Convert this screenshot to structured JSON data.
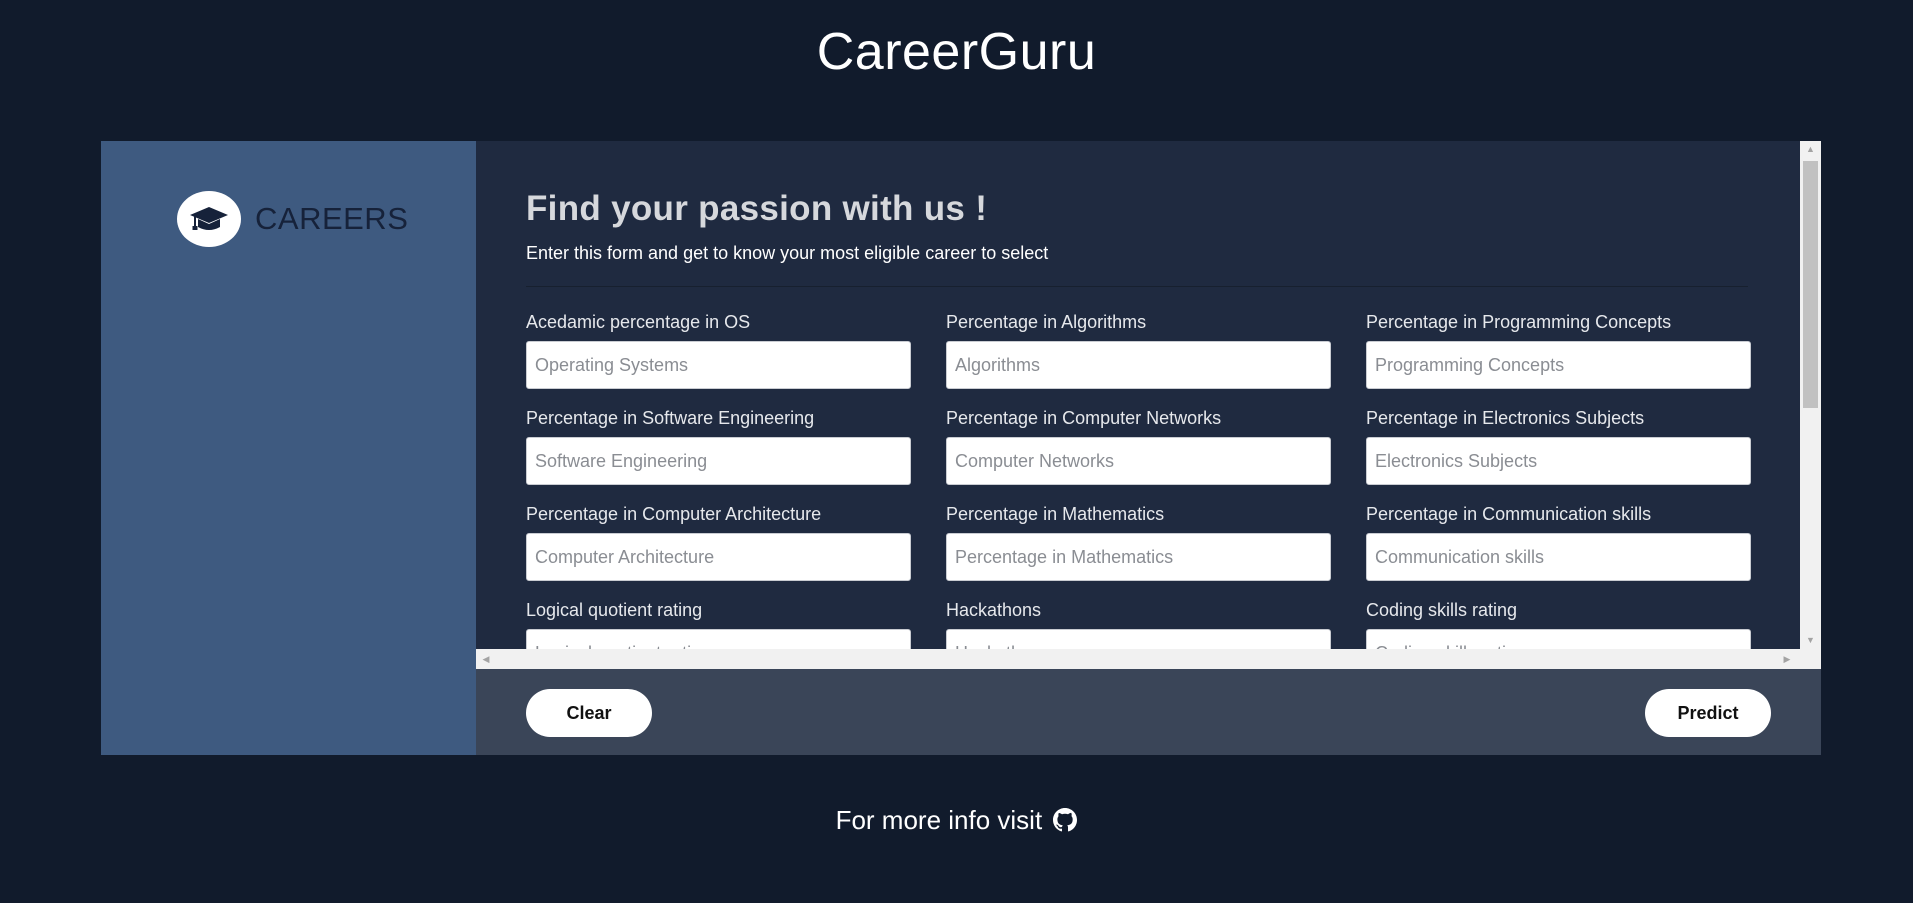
{
  "site": {
    "title": "CareerGuru"
  },
  "sidebar": {
    "brand_text": "CAREERS",
    "logo_icon": "graduation-cap-icon"
  },
  "form": {
    "heading": "Find your passion with us !",
    "subheading": "Enter this form and get to know your most eligible career to select",
    "fields": [
      {
        "label": "Acedamic percentage in OS",
        "placeholder": "Operating Systems",
        "value": ""
      },
      {
        "label": "Percentage in Algorithms",
        "placeholder": "Algorithms",
        "value": ""
      },
      {
        "label": "Percentage in Programming Concepts",
        "placeholder": "Programming Concepts",
        "value": ""
      },
      {
        "label": "Percentage in Software Engineering",
        "placeholder": "Software Engineering",
        "value": ""
      },
      {
        "label": "Percentage in Computer Networks",
        "placeholder": "Computer Networks",
        "value": ""
      },
      {
        "label": "Percentage in Electronics Subjects",
        "placeholder": "Electronics Subjects",
        "value": ""
      },
      {
        "label": "Percentage in Computer Architecture",
        "placeholder": "Computer Architecture",
        "value": ""
      },
      {
        "label": "Percentage in Mathematics",
        "placeholder": "Percentage in Mathematics",
        "value": ""
      },
      {
        "label": "Percentage in Communication skills",
        "placeholder": "Communication skills",
        "value": ""
      },
      {
        "label": "Logical quotient rating",
        "placeholder": "Logical quotient rating",
        "value": ""
      },
      {
        "label": "Hackathons",
        "placeholder": "Hackathons",
        "value": ""
      },
      {
        "label": "Coding skills rating",
        "placeholder": "Coding skills rating",
        "value": ""
      }
    ]
  },
  "actions": {
    "clear_label": "Clear",
    "predict_label": "Predict"
  },
  "footer": {
    "more_info_text": "For more info visit",
    "link_icon": "github-icon"
  },
  "colors": {
    "page_background": "#111b2c",
    "sidebar": "#3e5a80",
    "form_panel": "#1f2a40",
    "action_bar": "#3a4558",
    "heading_text": "#d6d8dc"
  }
}
